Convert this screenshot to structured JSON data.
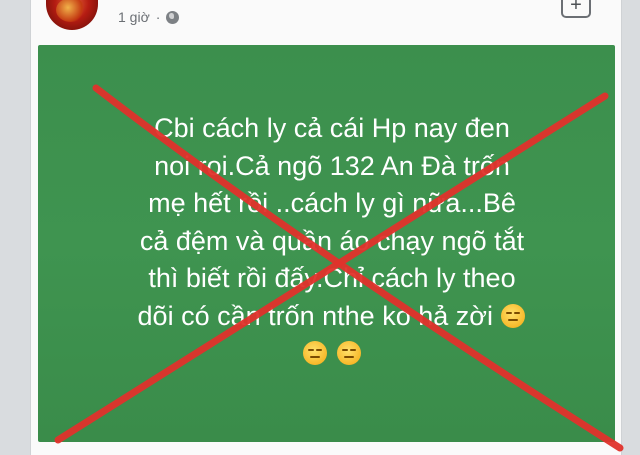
{
  "post": {
    "timestamp": "1 giờ",
    "privacy_icon": "globe-icon",
    "add_icon": "plus-icon",
    "text_lines": [
      "Cbi cách ly cả cái Hp nay đen",
      "noi roi.Cả ngõ 132 An Đà trốn",
      "mẹ hết rồi ..cách ly gì nữa...Bê",
      "cả đệm và quần áo chạy ngõ tắt",
      "thì biết rồi đấy.Chỉ cách ly theo",
      "dõi có cần trốn nthe ko hả zời"
    ],
    "emoji": "expressionless-face"
  },
  "colors": {
    "background": "#3c8f4d",
    "cross": "#e0312b",
    "text": "#ffffff"
  }
}
